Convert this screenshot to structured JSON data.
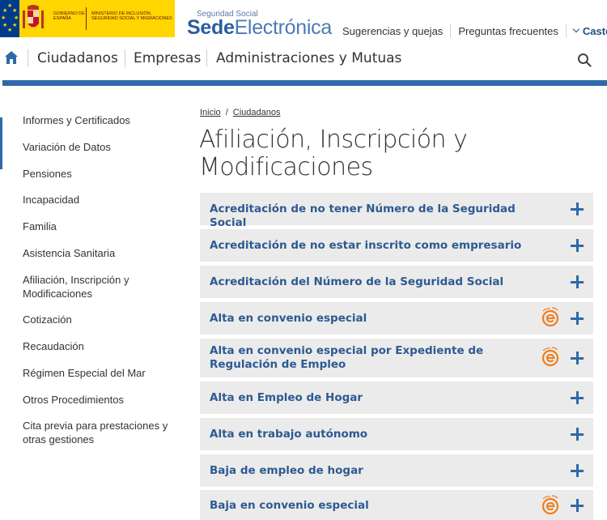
{
  "header": {
    "gov_name": "Gobierno de España",
    "ministry_name": "Ministerio de Inclusión, Seguridad Social y Migraciones",
    "brand_small": "Seguridad Social",
    "brand_bold": "Sede",
    "brand_light": "Electrónica",
    "links": [
      "Sugerencias y quejas",
      "Preguntas frecuentes"
    ],
    "language": "Castellano",
    "brand_color": "#2a5d9b",
    "gov_yellow": "#ffd600"
  },
  "nav": {
    "items": [
      "Ciudadanos",
      "Empresas",
      "Administraciones y Mutuas"
    ],
    "accent_color": "#2e6aa9"
  },
  "sidebar": {
    "items": [
      "Informes y Certificados",
      "Variación de Datos",
      "Pensiones",
      "Incapacidad",
      "Familia",
      "Asistencia Sanitaria",
      "Afiliación, Inscripción y Modificaciones",
      "Cotización",
      "Recaudación",
      "Régimen Especial del Mar",
      "Otros Procedimientos",
      "Cita previa para prestaciones y otras gestiones"
    ]
  },
  "breadcrumb": {
    "home": "Inicio",
    "separator": "/",
    "current": "Ciudadanos"
  },
  "page": {
    "title": "Afiliación, Inscripción y Modificaciones"
  },
  "accordion": {
    "items": [
      {
        "label": "Acreditación de no tener Número de la Seguridad Social",
        "electronic": false
      },
      {
        "label": "Acreditación de no estar inscrito como empresario",
        "electronic": false
      },
      {
        "label": "Acreditación del Número de la Seguridad Social",
        "electronic": false
      },
      {
        "label": "Alta en convenio especial",
        "electronic": true
      },
      {
        "label": "Alta en convenio especial por Expediente de Regulación de Empleo",
        "electronic": true
      },
      {
        "label": "Alta en Empleo de Hogar",
        "electronic": false
      },
      {
        "label": "Alta en trabajo autónomo",
        "electronic": false
      },
      {
        "label": "Baja de empleo de hogar",
        "electronic": false
      },
      {
        "label": "Baja en convenio especial",
        "electronic": true
      }
    ],
    "icons": {
      "expand": "plus-icon",
      "electronic": "electronic-procedure-icon"
    },
    "label_color": "#2d5a91",
    "electronic_color": "#f07d1a"
  }
}
